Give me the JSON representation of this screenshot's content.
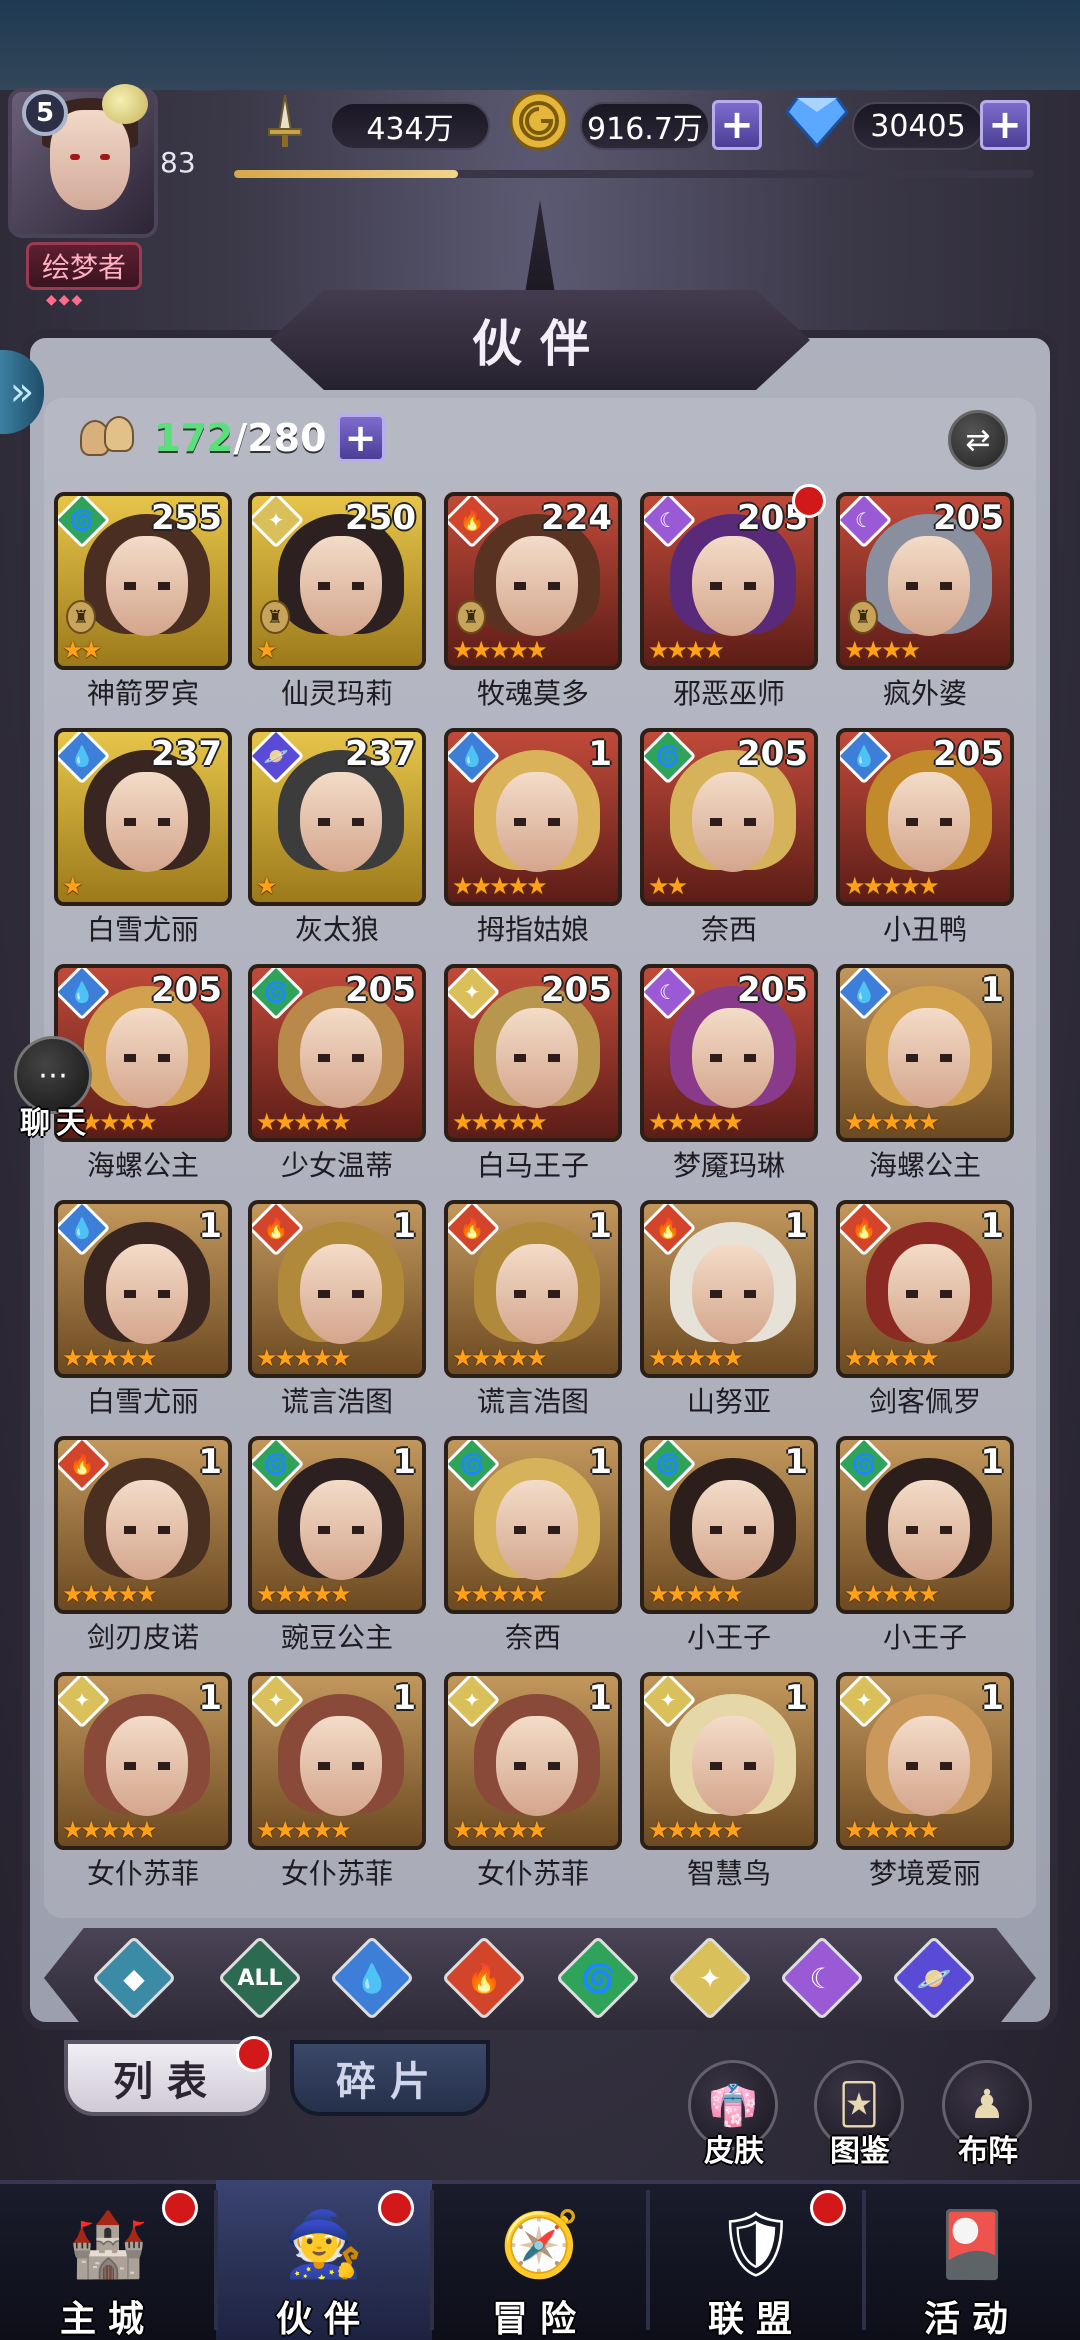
{
  "player": {
    "level": "5",
    "vip_level": "83",
    "title": "绘梦者",
    "title_dots": "◆◆◆"
  },
  "resources": {
    "power": "434万",
    "gold": "916.7万",
    "diamonds": "30405",
    "plus_glyph": "+",
    "exp_progress": 0.28
  },
  "panel": {
    "title": "伙伴",
    "count_current": "172",
    "count_separator": "/",
    "count_max": "280",
    "plus_glyph": "+",
    "swap_glyph": "⇄",
    "side_arrow": "»"
  },
  "colors": {
    "water": "#3d7fd8",
    "nature": "#2fa35a",
    "fire": "#d2452a",
    "light": "#d9c05a",
    "dark": "#9a5ad6",
    "cosmic": "#5a4bd6",
    "star": "#ffa21a"
  },
  "heroes": [
    {
      "name": "神箭罗宾",
      "level": "255",
      "element": "nature",
      "stars": 2,
      "rarity": "gold",
      "hair": "#4a2e22",
      "class_icon": true,
      "red_dot": false
    },
    {
      "name": "仙灵玛莉",
      "level": "250",
      "element": "light",
      "stars": 1,
      "rarity": "gold",
      "hair": "#2c2020",
      "class_icon": true,
      "red_dot": false
    },
    {
      "name": "牧魂莫多",
      "level": "224",
      "element": "fire",
      "stars": 5,
      "rarity": "red",
      "hair": "#5a3222",
      "class_icon": true,
      "red_dot": false
    },
    {
      "name": "邪恶巫师",
      "level": "205",
      "element": "dark",
      "stars": 4,
      "rarity": "red",
      "hair": "#5a2a7a",
      "class_icon": false,
      "red_dot": true
    },
    {
      "name": "疯外婆",
      "level": "205",
      "element": "dark",
      "stars": 4,
      "rarity": "red",
      "hair": "#8a8fa0",
      "class_icon": true,
      "red_dot": false
    },
    {
      "name": "白雪尤丽",
      "level": "237",
      "element": "water",
      "stars": 1,
      "rarity": "gold",
      "hair": "#3a2620",
      "class_icon": false,
      "red_dot": false
    },
    {
      "name": "灰太狼",
      "level": "237",
      "element": "cosmic",
      "stars": 1,
      "rarity": "gold",
      "hair": "#3c3c3c",
      "class_icon": false,
      "red_dot": false
    },
    {
      "name": "拇指姑娘",
      "level": "1",
      "element": "water",
      "stars": 5,
      "rarity": "red",
      "hair": "#d9b25a",
      "class_icon": false,
      "red_dot": false
    },
    {
      "name": "奈西",
      "level": "205",
      "element": "nature",
      "stars": 2,
      "rarity": "red",
      "hair": "#d6b35a",
      "class_icon": false,
      "red_dot": false
    },
    {
      "name": "小丑鸭",
      "level": "205",
      "element": "water",
      "stars": 5,
      "rarity": "red",
      "hair": "#c28a2a",
      "class_icon": false,
      "red_dot": false
    },
    {
      "name": "海螺公主",
      "level": "205",
      "element": "water",
      "stars": 5,
      "rarity": "red",
      "hair": "#d1a14e",
      "class_icon": false,
      "red_dot": false
    },
    {
      "name": "少女温蒂",
      "level": "205",
      "element": "nature",
      "stars": 5,
      "rarity": "red",
      "hair": "#b8894a",
      "class_icon": false,
      "red_dot": false
    },
    {
      "name": "白马王子",
      "level": "205",
      "element": "light",
      "stars": 5,
      "rarity": "red",
      "hair": "#b8964e",
      "class_icon": false,
      "red_dot": false
    },
    {
      "name": "梦魇玛琳",
      "level": "205",
      "element": "dark",
      "stars": 5,
      "rarity": "red",
      "hair": "#8a3a8a",
      "class_icon": false,
      "red_dot": false
    },
    {
      "name": "海螺公主",
      "level": "1",
      "element": "water",
      "stars": 5,
      "rarity": "bronze",
      "hair": "#d1a14e",
      "class_icon": false,
      "red_dot": false
    },
    {
      "name": "白雪尤丽",
      "level": "1",
      "element": "water",
      "stars": 5,
      "rarity": "bronze",
      "hair": "#3a2620",
      "class_icon": false,
      "red_dot": false
    },
    {
      "name": "谎言浩图",
      "level": "1",
      "element": "fire",
      "stars": 5,
      "rarity": "bronze",
      "hair": "#b08a3a",
      "class_icon": false,
      "red_dot": false
    },
    {
      "name": "谎言浩图",
      "level": "1",
      "element": "fire",
      "stars": 5,
      "rarity": "bronze",
      "hair": "#b08a3a",
      "class_icon": false,
      "red_dot": false
    },
    {
      "name": "山努亚",
      "level": "1",
      "element": "fire",
      "stars": 5,
      "rarity": "bronze",
      "hair": "#e6e2d8",
      "class_icon": false,
      "red_dot": false
    },
    {
      "name": "剑客佩罗",
      "level": "1",
      "element": "fire",
      "stars": 5,
      "rarity": "bronze",
      "hair": "#8a2a22",
      "class_icon": false,
      "red_dot": false
    },
    {
      "name": "剑刃皮诺",
      "level": "1",
      "element": "fire",
      "stars": 5,
      "rarity": "bronze",
      "hair": "#4a3020",
      "class_icon": false,
      "red_dot": false
    },
    {
      "name": "豌豆公主",
      "level": "1",
      "element": "nature",
      "stars": 5,
      "rarity": "bronze",
      "hair": "#2c2020",
      "class_icon": false,
      "red_dot": false
    },
    {
      "name": "奈西",
      "level": "1",
      "element": "nature",
      "stars": 5,
      "rarity": "bronze",
      "hair": "#d6b35a",
      "class_icon": false,
      "red_dot": false
    },
    {
      "name": "小王子",
      "level": "1",
      "element": "nature",
      "stars": 5,
      "rarity": "bronze",
      "hair": "#2c1e1a",
      "class_icon": false,
      "red_dot": false
    },
    {
      "name": "小王子",
      "level": "1",
      "element": "nature",
      "stars": 5,
      "rarity": "bronze",
      "hair": "#2c1e1a",
      "class_icon": false,
      "red_dot": false
    },
    {
      "name": "女仆苏菲",
      "level": "1",
      "element": "light",
      "stars": 5,
      "rarity": "bronze",
      "hair": "#8a4a3a",
      "class_icon": false,
      "red_dot": false
    },
    {
      "name": "女仆苏菲",
      "level": "1",
      "element": "light",
      "stars": 5,
      "rarity": "bronze",
      "hair": "#8a4a3a",
      "class_icon": false,
      "red_dot": false
    },
    {
      "name": "女仆苏菲",
      "level": "1",
      "element": "light",
      "stars": 5,
      "rarity": "bronze",
      "hair": "#8a4a3a",
      "class_icon": false,
      "red_dot": false
    },
    {
      "name": "智慧鸟",
      "level": "1",
      "element": "light",
      "stars": 5,
      "rarity": "bronze",
      "hair": "#e6d7a8",
      "class_icon": false,
      "red_dot": false
    },
    {
      "name": "梦境爱丽",
      "level": "1",
      "element": "light",
      "stars": 5,
      "rarity": "bronze",
      "hair": "#c9985a",
      "class_icon": false,
      "red_dot": false
    }
  ],
  "filters": [
    {
      "id": "shield",
      "glyph": "◆",
      "color": "#3b8aa6"
    },
    {
      "id": "all",
      "glyph": "ALL",
      "color": "#2d6a52"
    },
    {
      "id": "water",
      "glyph": "💧",
      "color": "#3d7fd8"
    },
    {
      "id": "fire",
      "glyph": "🔥",
      "color": "#d2452a"
    },
    {
      "id": "nature",
      "glyph": "🌀",
      "color": "#2fa35a"
    },
    {
      "id": "light",
      "glyph": "✦",
      "color": "#d9c05a"
    },
    {
      "id": "dark",
      "glyph": "☾",
      "color": "#9a5ad6"
    },
    {
      "id": "cosmic",
      "glyph": "🪐",
      "color": "#5a4bd6"
    }
  ],
  "tabs": {
    "list": "列表",
    "fragments": "碎片"
  },
  "shortcuts": [
    {
      "id": "skin",
      "label": "皮肤",
      "glyph": "👘"
    },
    {
      "id": "codex",
      "label": "图鉴",
      "glyph": "🃏"
    },
    {
      "id": "formation",
      "label": "布阵",
      "glyph": "♟"
    }
  ],
  "chat": {
    "label": "聊天",
    "glyph": "⋯"
  },
  "nav": [
    {
      "id": "city",
      "label": "主城",
      "glyph": "🏰",
      "red_dot": true,
      "active": false
    },
    {
      "id": "partners",
      "label": "伙伴",
      "glyph": "🧙",
      "red_dot": true,
      "active": true
    },
    {
      "id": "adventure",
      "label": "冒险",
      "glyph": "🧭",
      "red_dot": false,
      "active": false
    },
    {
      "id": "alliance",
      "label": "联盟",
      "glyph": "🛡",
      "red_dot": true,
      "active": false
    },
    {
      "id": "events",
      "label": "活动",
      "glyph": "🎴",
      "red_dot": false,
      "active": false
    }
  ]
}
